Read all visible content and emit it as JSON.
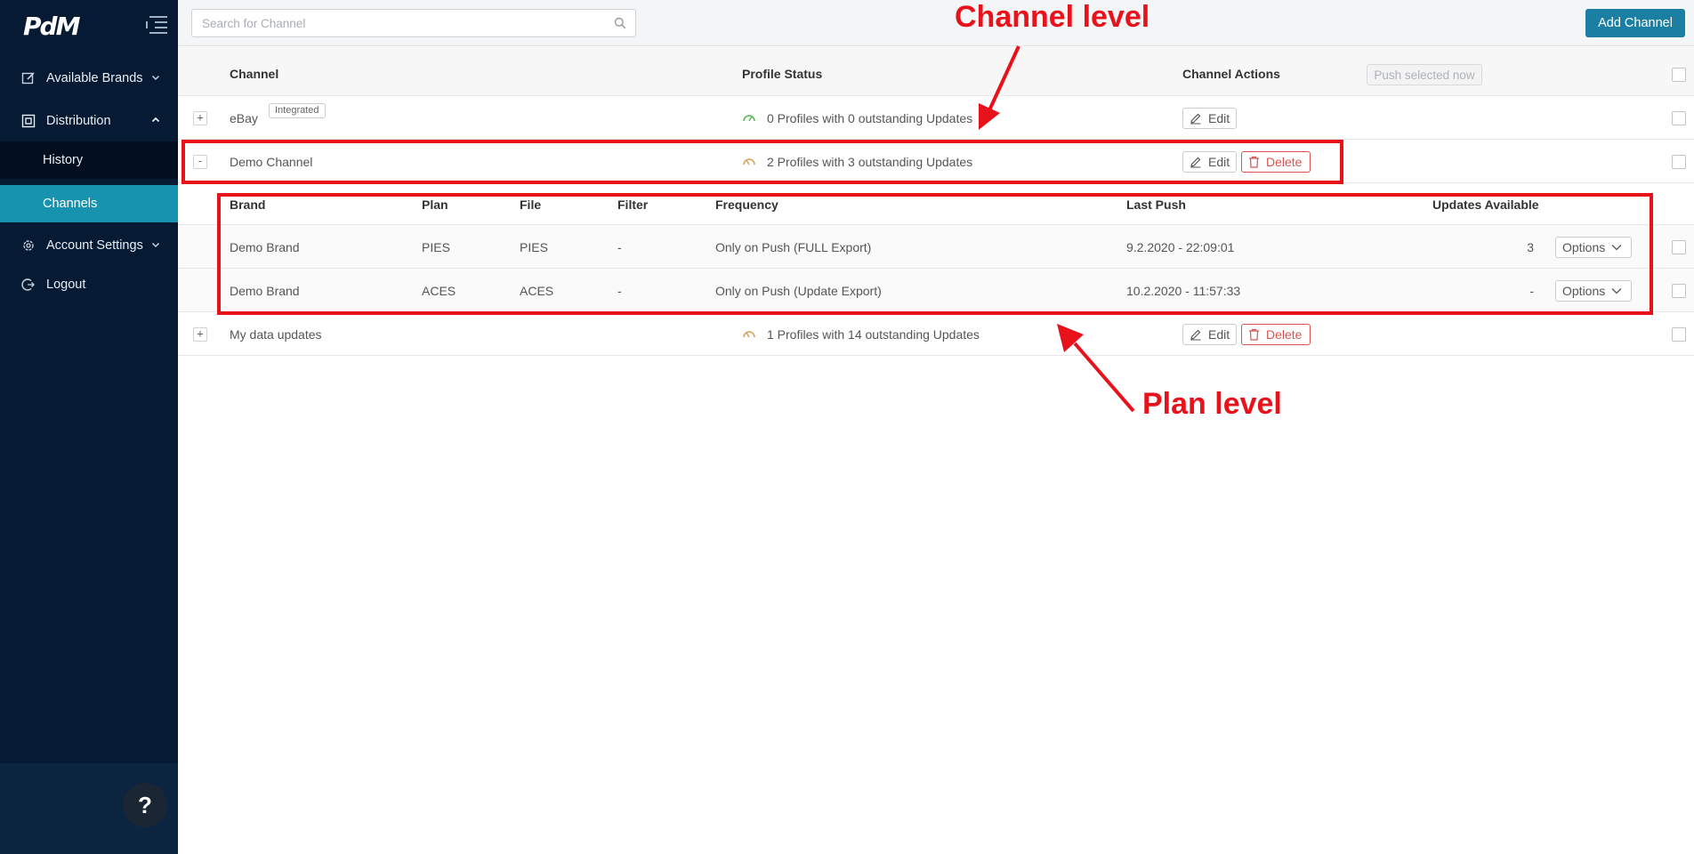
{
  "app": {
    "logo_text": "PdM"
  },
  "sidebar": {
    "items": [
      {
        "label": "Available Brands",
        "icon": "edit-square-icon"
      },
      {
        "label": "Distribution",
        "icon": "distribution-icon"
      },
      {
        "label": "History"
      },
      {
        "label": "Channels",
        "active": true
      },
      {
        "label": "Account Settings",
        "icon": "gear-icon"
      },
      {
        "label": "Logout",
        "icon": "logout-icon"
      }
    ],
    "help_label": "?"
  },
  "topbar": {
    "search_placeholder": "Search for Channel",
    "add_channel_label": "Add Channel"
  },
  "table": {
    "headers": {
      "channel": "Channel",
      "profile_status": "Profile Status",
      "channel_actions": "Channel Actions"
    },
    "push_selected_label": "Push selected now",
    "edit_label": "Edit",
    "delete_label": "Delete",
    "channels": [
      {
        "toggle": "+",
        "name": "eBay",
        "tag": "Integrated",
        "status": "0 Profiles with 0 outstanding Updates",
        "status_color": "#5cb85c"
      },
      {
        "toggle": "-",
        "name": "Demo Channel",
        "status": "2 Profiles with 3 outstanding Updates",
        "status_color": "#d9a25a"
      },
      {
        "toggle": "+",
        "name": "My data updates",
        "status": "1 Profiles with 14 outstanding Updates",
        "status_color": "#d9a25a"
      }
    ],
    "plans": {
      "headers": {
        "brand": "Brand",
        "plan": "Plan",
        "file": "File",
        "filter": "Filter",
        "frequency": "Frequency",
        "last_push": "Last Push",
        "updates_available": "Updates Available"
      },
      "options_label": "Options",
      "rows": [
        {
          "brand": "Demo Brand",
          "plan": "PIES",
          "file": "PIES",
          "filter": "-",
          "frequency": "Only on Push (FULL Export)",
          "last_push": "9.2.2020 - 22:09:01",
          "updates": "3"
        },
        {
          "brand": "Demo Brand",
          "plan": "ACES",
          "file": "ACES",
          "filter": "-",
          "frequency": "Only on Push (Update Export)",
          "last_push": "10.2.2020 - 11:57:33",
          "updates": "-"
        }
      ]
    }
  },
  "annotations": {
    "channel_level": "Channel level",
    "plan_level": "Plan level",
    "color": "#e8121b"
  }
}
